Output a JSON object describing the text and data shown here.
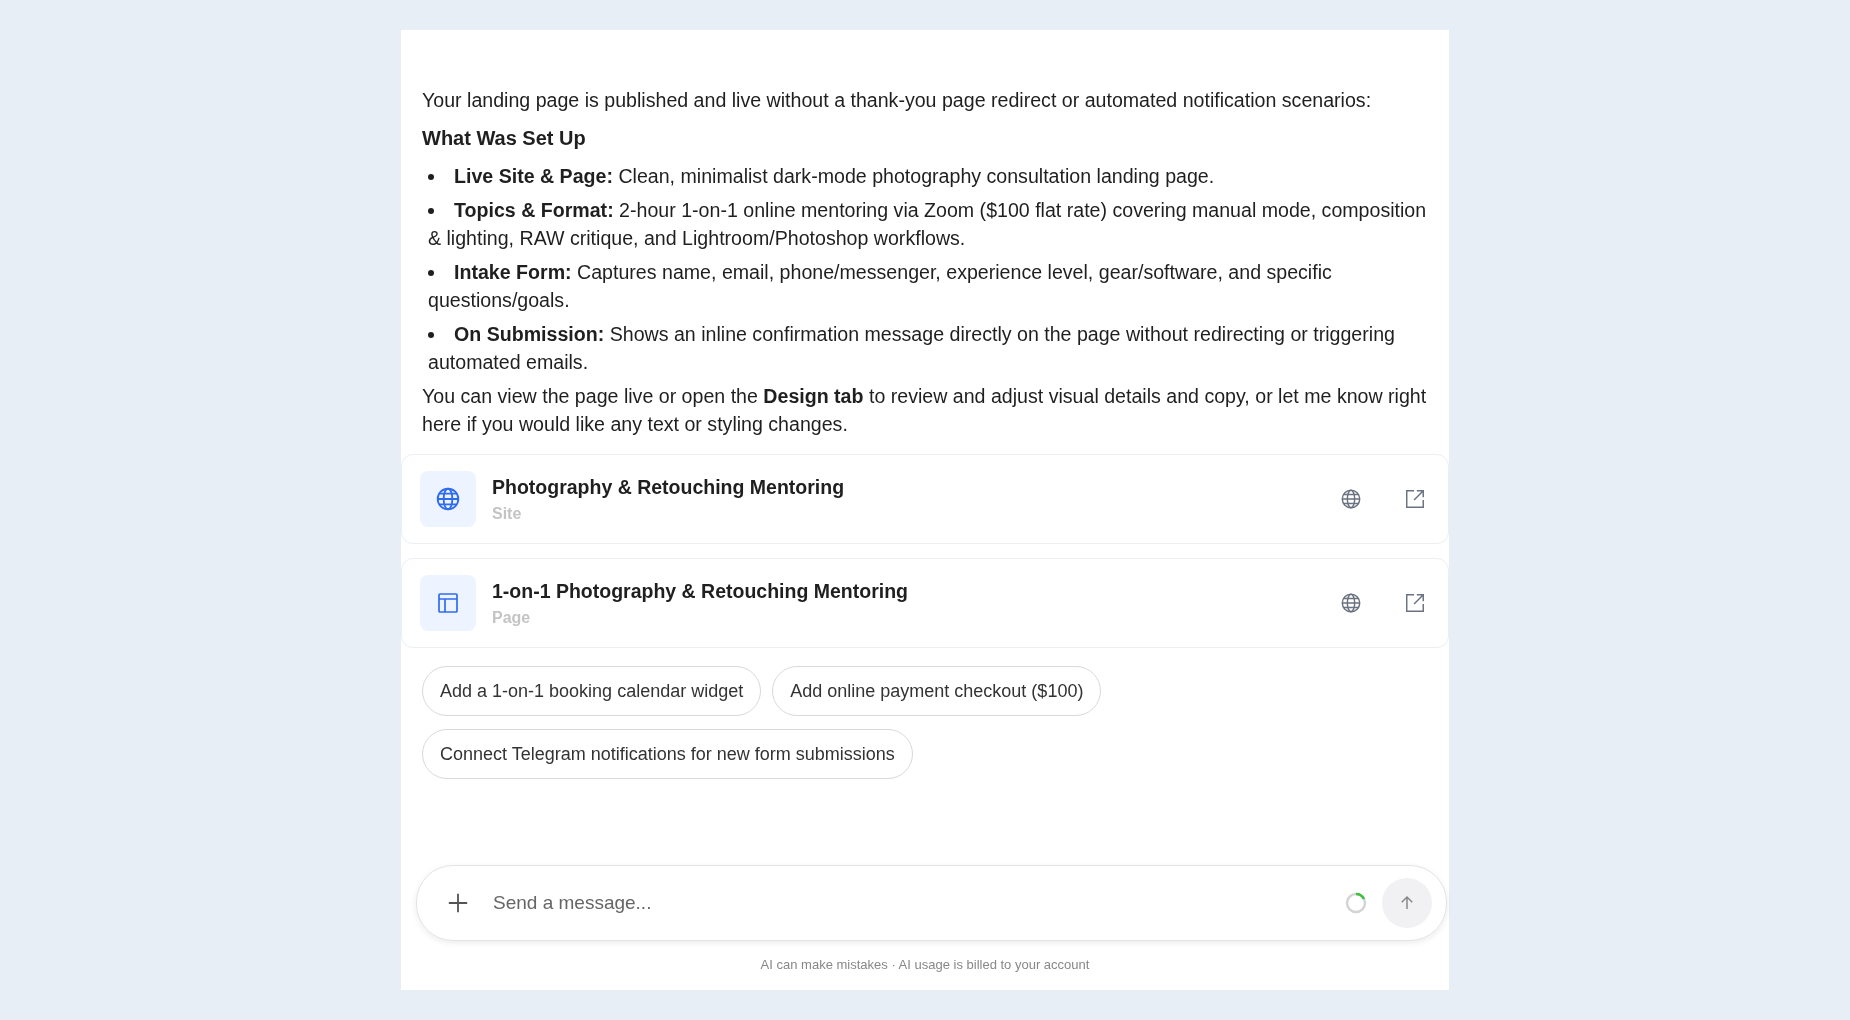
{
  "message": {
    "intro": "Your landing page is published and live without a thank-you page redirect or automated notification scenarios:",
    "heading": "What Was Set Up",
    "bullets": [
      "**Live Site & Page:** Clean, minimalist dark-mode photography consultation landing page.",
      "**Topics & Format:** 2-hour 1-on-1 online mentoring via Zoom ($100 flat rate) covering manual mode, composition & lighting, RAW critique, and Lightroom/Photoshop workflows.",
      "**Intake Form:** Captures name, email, phone/messenger, experience level, gear/software, and specific questions/goals.",
      "**On Submission:** Shows an inline confirmation message directly on the page without redirecting or triggering automated emails."
    ],
    "outro": "You can view the page live or open the **Design tab** to review and adjust visual details and copy, or let me know right here if you would like any text or styling changes."
  },
  "resources": [
    {
      "kind": "site",
      "title": "Photography & Retouching Mentoring",
      "subtitle": "Site"
    },
    {
      "kind": "page",
      "title": "1-on-1 Photography & Retouching Mentoring",
      "subtitle": "Page"
    }
  ],
  "suggestions": [
    "Add a 1-on-1 booking calendar widget",
    "Add online payment checkout ($100)",
    "Connect Telegram notifications for new form submissions"
  ],
  "composer": {
    "placeholder": "Send a message..."
  },
  "footer": "AI can make mistakes · AI usage is billed to your account"
}
